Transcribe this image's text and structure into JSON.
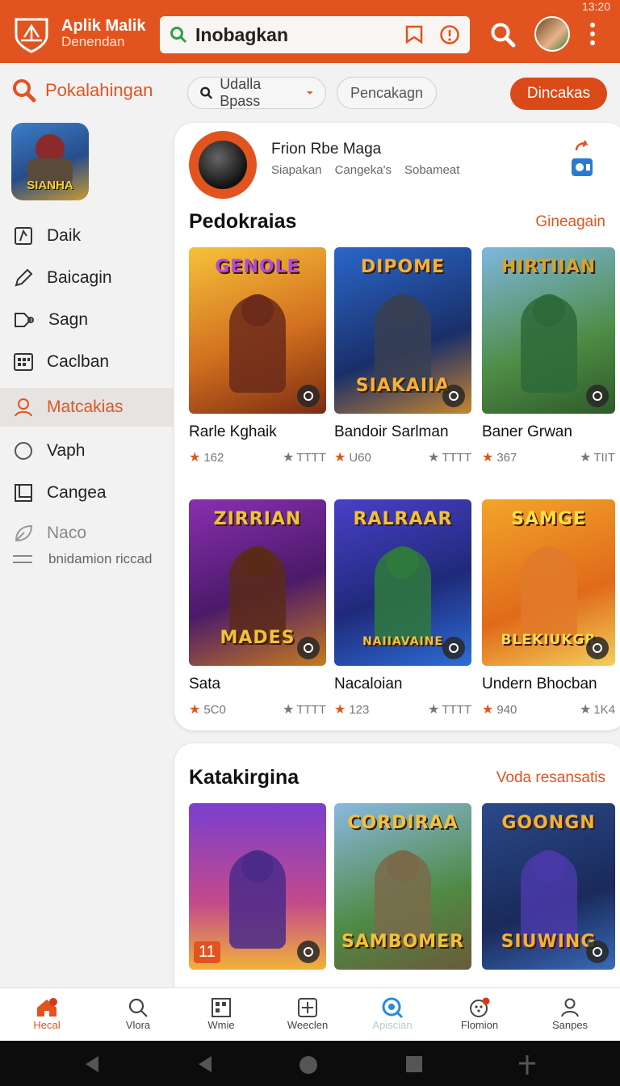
{
  "status": {
    "time": "13:20"
  },
  "header": {
    "app_name": "Aplik Malik",
    "app_subtitle": "Denendan",
    "search_value": "Inobagkan"
  },
  "secondary": {
    "title": "Pokalahingan",
    "filter_pill": "Udalla Bpass",
    "second_pill": "Pencakagn",
    "cta": "Dincakas"
  },
  "sidebar": {
    "items": [
      {
        "label": "Daik"
      },
      {
        "label": "Baicagin"
      },
      {
        "label": "Sagn"
      },
      {
        "label": "Caclban"
      },
      {
        "label": "Matcakias"
      },
      {
        "label": "Vaph"
      },
      {
        "label": "Cangea"
      },
      {
        "label": "Naco"
      }
    ],
    "sub_label": "bnidamion riccad",
    "thumb_title": "SIANHA"
  },
  "profile": {
    "name": "Frion Rbe Maga",
    "meta": [
      "Siapakan",
      "Cangeka's",
      "Sobameat"
    ]
  },
  "section1": {
    "title": "Pedokraias",
    "link": "Gineagain",
    "games": [
      {
        "title": "Rarle Kghaik",
        "rating": "162",
        "count": "TTTT",
        "art_top": "GENOLE",
        "art_bottom": "",
        "bg": "linear-gradient(160deg,#f6c23a,#d2701f 55%,#7a2b12)",
        "fig": "#6b2a1a",
        "title_color": "#b24ad8"
      },
      {
        "title": "Bandoir Sarlman",
        "rating": "U60",
        "count": "TTTT",
        "art_top": "DIPOME",
        "art_bottom": "SIAKAIIA",
        "bg": "linear-gradient(160deg,#2a67c9,#1a2f6a 60%,#c6862e)",
        "fig": "#3a3f52",
        "title_color": "#f0b23b"
      },
      {
        "title": "Baner Grwan",
        "rating": "367",
        "count": "TIIT",
        "art_top": "HIRTIIAN",
        "art_bottom": "",
        "bg": "linear-gradient(160deg,#7fb6e0,#4e8c44 60%,#2d5a2a)",
        "fig": "#2d6a3a",
        "title_color": "#d4a62a"
      }
    ]
  },
  "section1b": {
    "games": [
      {
        "title": "Sata",
        "rating": "5C0",
        "count": "TTTT",
        "art_top": "ZIRRIAN",
        "art_bottom": "MADES",
        "bg": "linear-gradient(160deg,#8a2fb0,#4b1a6a 55%,#c77a1e)",
        "fig": "#5b2a18",
        "title_color": "#f0c23b"
      },
      {
        "title": "Nacaloian",
        "rating": "123",
        "count": "TTTT",
        "art_top": "RALRAAR",
        "art_bottom": "NAIIAVAINE",
        "bg": "linear-gradient(160deg,#4b3fc8,#1f2a7a 55%,#2d6ed8)",
        "fig": "#2f7a3c",
        "title_color": "#f0c23b"
      },
      {
        "title": "Undern Bhocban",
        "rating": "940",
        "count": "1K4",
        "art_top": "SAMGE",
        "art_bottom": "BLEKIUKGR",
        "bg": "linear-gradient(160deg,#f2a52a,#e06a1a 60%,#f4cf5a)",
        "fig": "#e07a2a",
        "title_color": "#ffdd44"
      }
    ]
  },
  "section2": {
    "title": "Katakirgina",
    "link": "Voda resansatis",
    "games": [
      {
        "art_top": "",
        "art_bottom": "",
        "badge": "11",
        "bg": "linear-gradient(180deg,#7a3fd0,#c44a8a 60%,#f0b23b)",
        "fig": "#4b2a8a",
        "title_color": "#fff"
      },
      {
        "art_top": "CORDIRAA",
        "art_bottom": "SAMBOMER",
        "bg": "linear-gradient(160deg,#8ab8e0,#4f8a44 60%,#6a5a3a)",
        "fig": "#7a6a4a",
        "title_color": "#f0c23b"
      },
      {
        "art_top": "GOONGN",
        "art_bottom": "SIUWING",
        "bg": "linear-gradient(160deg,#2a4a8a,#1a2a5a 60%,#3a6ab8)",
        "fig": "#4a3aa8",
        "title_color": "#f0b23b"
      }
    ]
  },
  "bottom_nav": [
    {
      "label": "Hecal"
    },
    {
      "label": "Vlora"
    },
    {
      "label": "Wmie"
    },
    {
      "label": "Weeclen"
    },
    {
      "label": "Apiscian"
    },
    {
      "label": "Flomion"
    },
    {
      "label": "Sanpes"
    }
  ]
}
